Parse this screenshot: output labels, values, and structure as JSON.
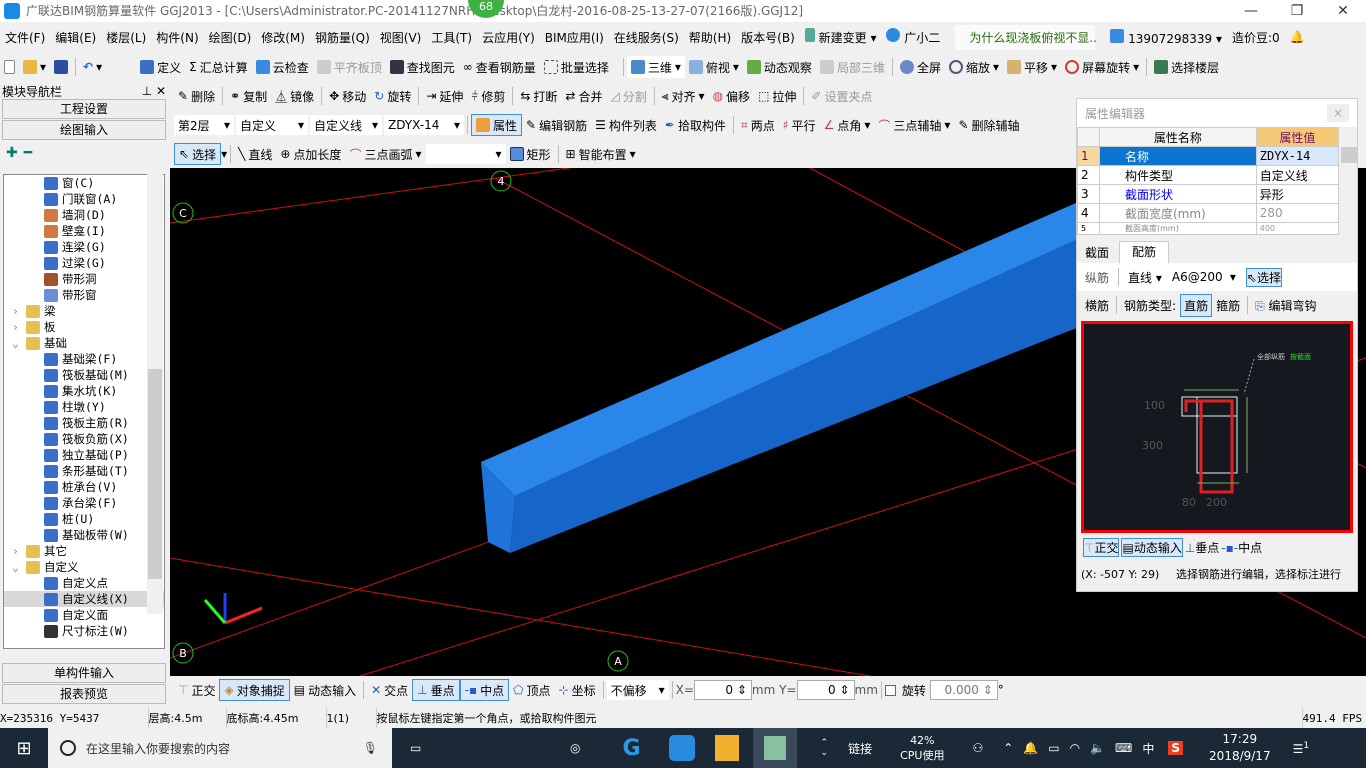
{
  "window": {
    "title": "广联达BIM钢筋算量软件 GGJ2013 - [C:\\Users\\Administrator.PC-20141127NRHI\\Desktop\\白龙村-2016-08-25-13-27-07(2166版).GGJ12]",
    "badge": "68"
  },
  "menu": [
    "文件(F)",
    "编辑(E)",
    "楼层(L)",
    "构件(N)",
    "绘图(D)",
    "修改(M)",
    "钢筋量(Q)",
    "视图(V)",
    "工具(T)",
    "云应用(Y)",
    "BIM应用(I)",
    "在线服务(S)",
    "帮助(H)",
    "版本号(B)"
  ],
  "menu_right": {
    "new_change": "新建变更",
    "assistant": "广小二",
    "tip": "为什么现浇板俯视不显..",
    "phone": "13907298339",
    "beans": "造价豆:0"
  },
  "toolbar1": [
    "定义",
    "汇总计算",
    "云检查",
    "平齐板顶",
    "查找图元",
    "查看钢筋量",
    "批量选择"
  ],
  "toolbar1_right": [
    "三维",
    "俯视",
    "动态观察",
    "局部三维",
    "全屏",
    "缩放",
    "平移",
    "屏幕旋转",
    "选择楼层"
  ],
  "toolbar2": [
    "删除",
    "复制",
    "镜像",
    "移动",
    "旋转",
    "延伸",
    "修剪",
    "打断",
    "合并",
    "分割",
    "对齐",
    "偏移",
    "拉伸",
    "设置夹点"
  ],
  "toolbar3": {
    "floor": "第2层",
    "category": "自定义",
    "type": "自定义线",
    "element": "ZDYX-14",
    "buttons": [
      "属性",
      "编辑钢筋",
      "构件列表",
      "拾取构件"
    ],
    "axis_buttons": [
      "两点",
      "平行",
      "点角",
      "三点辅轴",
      "删除辅轴"
    ]
  },
  "toolbar4": {
    "buttons": [
      "选择",
      "直线",
      "点加长度",
      "三点画弧"
    ],
    "combo": "",
    "more": [
      "矩形",
      "智能布置"
    ]
  },
  "nav": {
    "title": "模块导航栏",
    "project_settings": "工程设置",
    "drawing_input": "绘图输入",
    "single_input": "单构件输入",
    "report_preview": "报表预览",
    "tree": [
      {
        "label": "窗(C)",
        "level": 2,
        "color": "#3a6fc8"
      },
      {
        "label": "门联窗(A)",
        "level": 2,
        "color": "#3a6fc8"
      },
      {
        "label": "墙洞(D)",
        "level": 2,
        "color": "#d07a40"
      },
      {
        "label": "壁龛(I)",
        "level": 2,
        "color": "#d07a40"
      },
      {
        "label": "连梁(G)",
        "level": 2,
        "color": "#3a6fc8"
      },
      {
        "label": "过梁(G)",
        "level": 2,
        "color": "#3a6fc8"
      },
      {
        "label": "带形洞",
        "level": 2,
        "color": "#a0522d"
      },
      {
        "label": "带形窗",
        "level": 2,
        "color": "#6a8fd8"
      },
      {
        "label": "梁",
        "level": 1,
        "color": "#e8c050"
      },
      {
        "label": "板",
        "level": 1,
        "color": "#e8c050"
      },
      {
        "label": "基础",
        "level": 1,
        "color": "#e8c050"
      },
      {
        "label": "基础梁(F)",
        "level": 2,
        "color": "#3a6fc8"
      },
      {
        "label": "筏板基础(M)",
        "level": 2,
        "color": "#3a6fc8"
      },
      {
        "label": "集水坑(K)",
        "level": 2,
        "color": "#3a6fc8"
      },
      {
        "label": "柱墩(Y)",
        "level": 2,
        "color": "#3a6fc8"
      },
      {
        "label": "筏板主筋(R)",
        "level": 2,
        "color": "#3a6fc8"
      },
      {
        "label": "筏板负筋(X)",
        "level": 2,
        "color": "#3a6fc8"
      },
      {
        "label": "独立基础(P)",
        "level": 2,
        "color": "#3a6fc8"
      },
      {
        "label": "条形基础(T)",
        "level": 2,
        "color": "#3a6fc8"
      },
      {
        "label": "桩承台(V)",
        "level": 2,
        "color": "#3a6fc8"
      },
      {
        "label": "承台梁(F)",
        "level": 2,
        "color": "#3a6fc8"
      },
      {
        "label": "桩(U)",
        "level": 2,
        "color": "#3a6fc8"
      },
      {
        "label": "基础板带(W)",
        "level": 2,
        "color": "#3a6fc8"
      },
      {
        "label": "其它",
        "level": 1,
        "color": "#e8c050"
      },
      {
        "label": "自定义",
        "level": 1,
        "color": "#e8c050"
      },
      {
        "label": "自定义点",
        "level": 2,
        "color": "#3a6fc8"
      },
      {
        "label": "自定义线(X)",
        "level": 2,
        "color": "#3a6fc8",
        "selected": true
      },
      {
        "label": "自定义面",
        "level": 2,
        "color": "#3a6fc8"
      },
      {
        "label": "尺寸标注(W)",
        "level": 2,
        "color": "#333"
      }
    ]
  },
  "viewport": {
    "axis_labels": [
      "C",
      "4",
      "B",
      "A"
    ],
    "beam_color": "#1a73d9",
    "grid_color": "#d01010"
  },
  "prop": {
    "title": "属性编辑器",
    "col_name": "属性名称",
    "col_value": "属性值",
    "rows": [
      {
        "n": "1",
        "name": "名称",
        "value": "ZDYX-14"
      },
      {
        "n": "2",
        "name": "构件类型",
        "value": "自定义线"
      },
      {
        "n": "3",
        "name": "截面形状",
        "value": "异形"
      },
      {
        "n": "4",
        "name": "截面宽度(mm)",
        "value": "280"
      },
      {
        "n": "5",
        "name": "截面高度(mm)",
        "value": "400"
      }
    ],
    "tabs": [
      "截面",
      "配筋"
    ],
    "long_label": "纵筋",
    "line_type": "直线",
    "spec": "A6@200",
    "select": "选择",
    "trans_label": "横筋",
    "rebar_type": "钢筋类型:",
    "straight": "直筋",
    "stirrup": "箍筋",
    "edit_hook": "编辑弯钩",
    "drawing": {
      "annot": "全部纵筋",
      "annot2": "按截面",
      "dims": [
        "100",
        "300",
        "80",
        "200"
      ]
    },
    "bottom": [
      "正交",
      "动态输入",
      "垂点",
      "中点"
    ],
    "coord": "(X: -507 Y: 29)",
    "hint": "选择钢筋进行编辑，选择标注进行"
  },
  "bottombar": {
    "buttons": [
      "正交",
      "对象捕捉",
      "动态输入",
      "交点",
      "垂点",
      "中点",
      "顶点",
      "坐标"
    ],
    "offset": "不偏移",
    "x_label": "X=",
    "x": "0",
    "y_label": "Y=",
    "y": "0",
    "unit": "mm",
    "rotate": "旋转",
    "angle": "0.000",
    "deg": "°"
  },
  "status": {
    "coords": "X=235316 Y=5437",
    "floor_h": "层高:4.5m",
    "base_h": "底标高:4.45m",
    "count": "1(1)",
    "msg": "按鼠标左键指定第一个角点，或拾取构件图元",
    "fps": "491.4 FPS"
  },
  "taskbar": {
    "search": "在这里输入你要搜索的内容",
    "link": "链接",
    "cpu": "42%",
    "cpu_label": "CPU使用",
    "ime": "中",
    "time": "17:29",
    "date": "2018/9/17",
    "notif": "1"
  }
}
